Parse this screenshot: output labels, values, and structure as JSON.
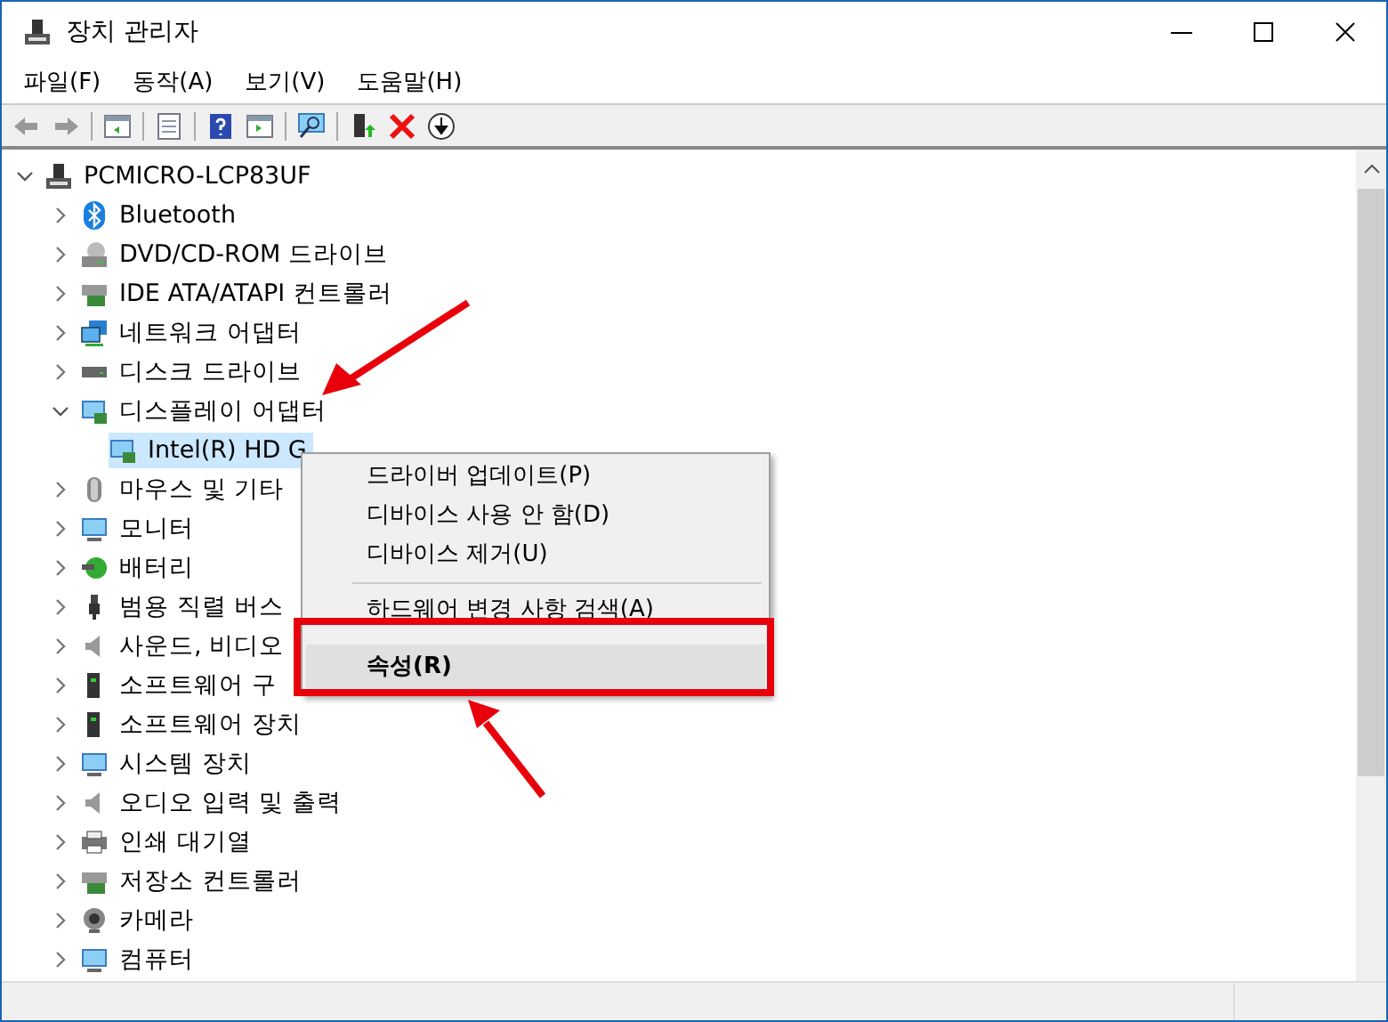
{
  "window": {
    "title": "장치 관리자"
  },
  "menu_bar": [
    "파일(F)",
    "동작(A)",
    "보기(V)",
    "도움말(H)"
  ],
  "tree": {
    "label": "PCMICRO-LCP83UF",
    "expanded": true,
    "children": [
      {
        "label": "Bluetooth",
        "expanded": false
      },
      {
        "label": "DVD/CD-ROM 드라이브",
        "expanded": false
      },
      {
        "label": "IDE ATA/ATAPI 컨트롤러",
        "expanded": false
      },
      {
        "label": "네트워크 어댑터",
        "expanded": false
      },
      {
        "label": "디스크 드라이브",
        "expanded": false
      },
      {
        "label": "디스플레이 어댑터",
        "expanded": true,
        "children": [
          {
            "label": "Intel(R) HD G",
            "selected": true
          }
        ]
      },
      {
        "label": "마우스 및 기타",
        "expanded": false
      },
      {
        "label": "모니터",
        "expanded": false
      },
      {
        "label": "배터리",
        "expanded": false
      },
      {
        "label": "범용 직렬 버스",
        "expanded": false
      },
      {
        "label": "사운드, 비디오",
        "expanded": false
      },
      {
        "label": "소프트웨어 구",
        "expanded": false
      },
      {
        "label": "소프트웨어 장치",
        "expanded": false
      },
      {
        "label": "시스템 장치",
        "expanded": false
      },
      {
        "label": "오디오 입력 및 출력",
        "expanded": false
      },
      {
        "label": "인쇄 대기열",
        "expanded": false
      },
      {
        "label": "저장소 컨트롤러",
        "expanded": false
      },
      {
        "label": "카메라",
        "expanded": false
      },
      {
        "label": "컴퓨터",
        "expanded": false
      }
    ]
  },
  "context_menu": [
    {
      "label": "드라이버 업데이트(P)",
      "kind": "item",
      "selected": false
    },
    {
      "label": "디바이스 사용 안 함(D)",
      "kind": "item",
      "selected": false
    },
    {
      "label": "디바이스 제거(U)",
      "kind": "item",
      "selected": false
    },
    {
      "kind": "separator"
    },
    {
      "label": "하드웨어 변경 사항 검색(A)",
      "kind": "item",
      "selected": false
    },
    {
      "label": "속성(R)",
      "kind": "default",
      "selected": true
    }
  ]
}
